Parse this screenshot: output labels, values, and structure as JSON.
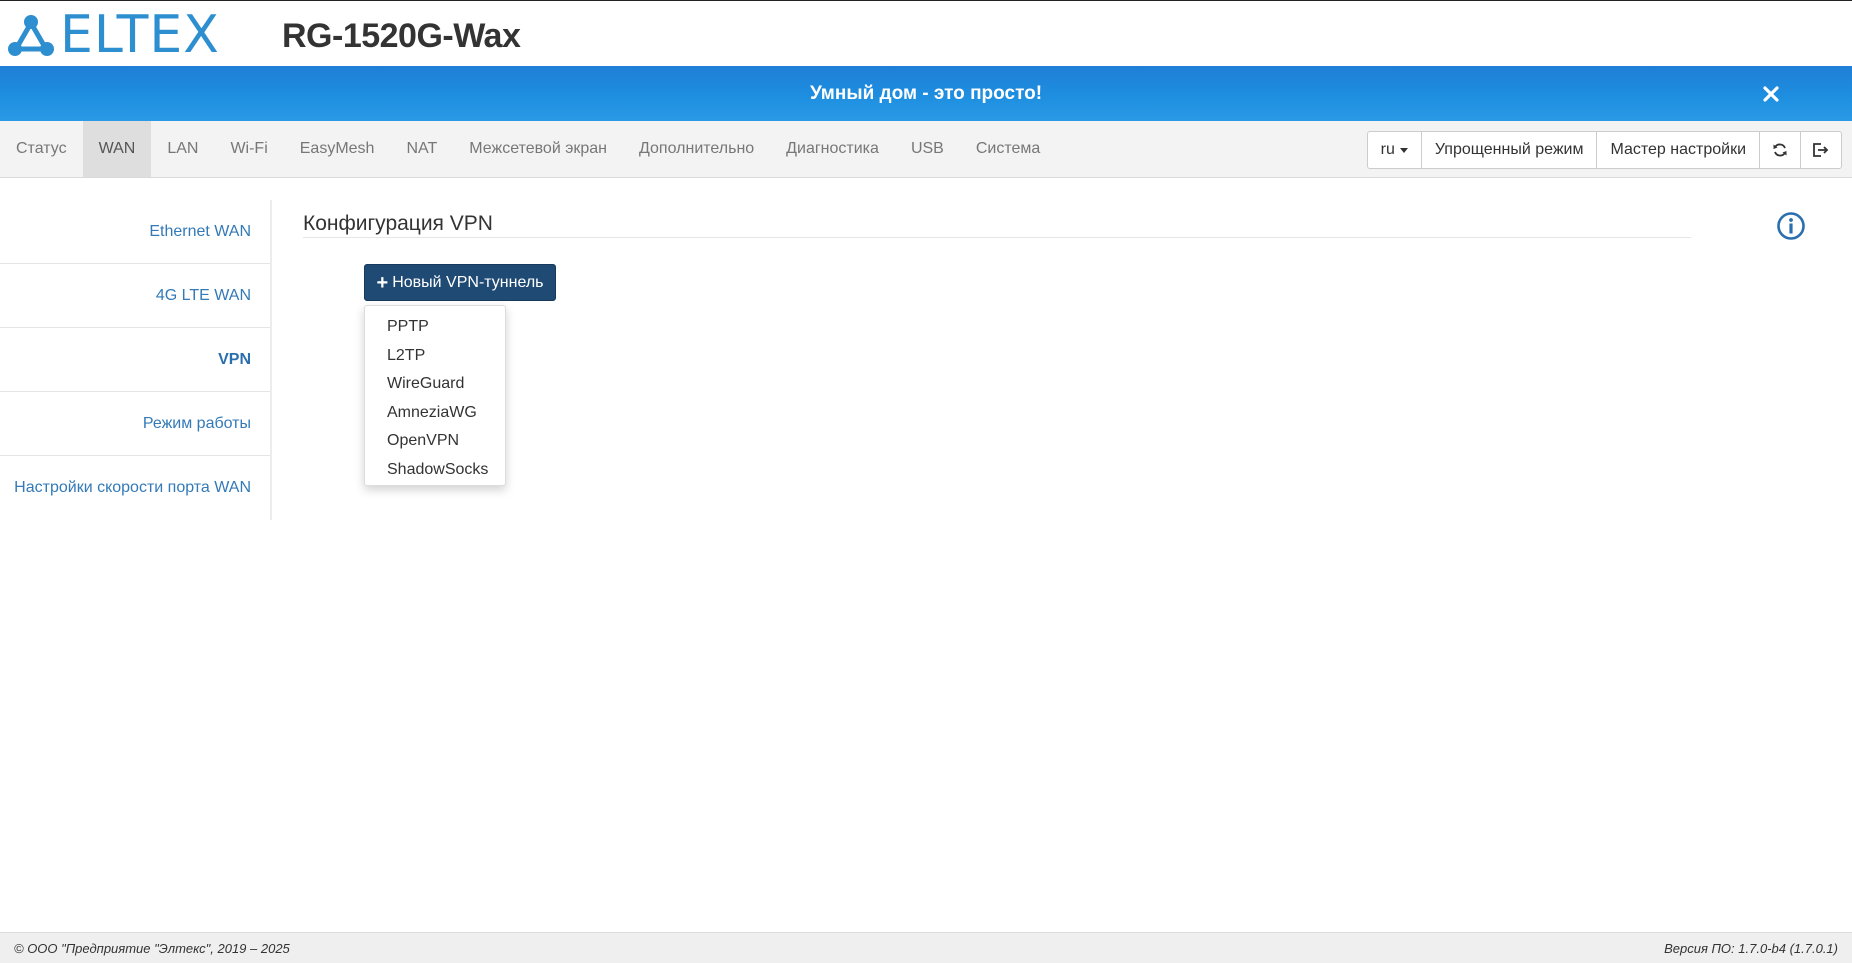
{
  "header": {
    "logo_text": "ELTEX",
    "model": "RG-1520G-Wax"
  },
  "banner": {
    "text": "Умный дом - это просто!",
    "close_icon": "close-icon"
  },
  "navbar": {
    "items": [
      {
        "label": "Статус"
      },
      {
        "label": "WAN",
        "active": true
      },
      {
        "label": "LAN"
      },
      {
        "label": "Wi-Fi"
      },
      {
        "label": "EasyMesh"
      },
      {
        "label": "NAT"
      },
      {
        "label": "Межсетевой экран"
      },
      {
        "label": "Дополнительно"
      },
      {
        "label": "Диагностика"
      },
      {
        "label": "USB"
      },
      {
        "label": "Система"
      }
    ],
    "language": "ru",
    "simple_mode_label": "Упрощенный режим",
    "wizard_label": "Мастер настройки",
    "refresh_icon": "refresh-icon",
    "logout_icon": "logout-icon"
  },
  "sidebar": {
    "items": [
      {
        "label": "Ethernet WAN"
      },
      {
        "label": "4G LTE WAN"
      },
      {
        "label": "VPN",
        "active": true
      },
      {
        "label": "Режим работы"
      },
      {
        "label": "Настройки скорости порта WAN"
      }
    ]
  },
  "main": {
    "title": "Конфигурация VPN",
    "info_icon": "info-icon",
    "new_tunnel_label": "Новый VPN-туннель",
    "dropdown": [
      "PPTP",
      "L2TP",
      "WireGuard",
      "AmneziaWG",
      "OpenVPN",
      "ShadowSocks"
    ]
  },
  "footer": {
    "copyright": "© ООО \"Предприятие \"Элтекс\", 2019 – 2025",
    "version": "Версия ПО: 1.7.0-b4 (1.7.0.1)"
  },
  "colors": {
    "brand": "#2e8fd0",
    "banner": "#1e8ee0",
    "primary_button": "#1f4a74",
    "link": "#337ab7"
  }
}
